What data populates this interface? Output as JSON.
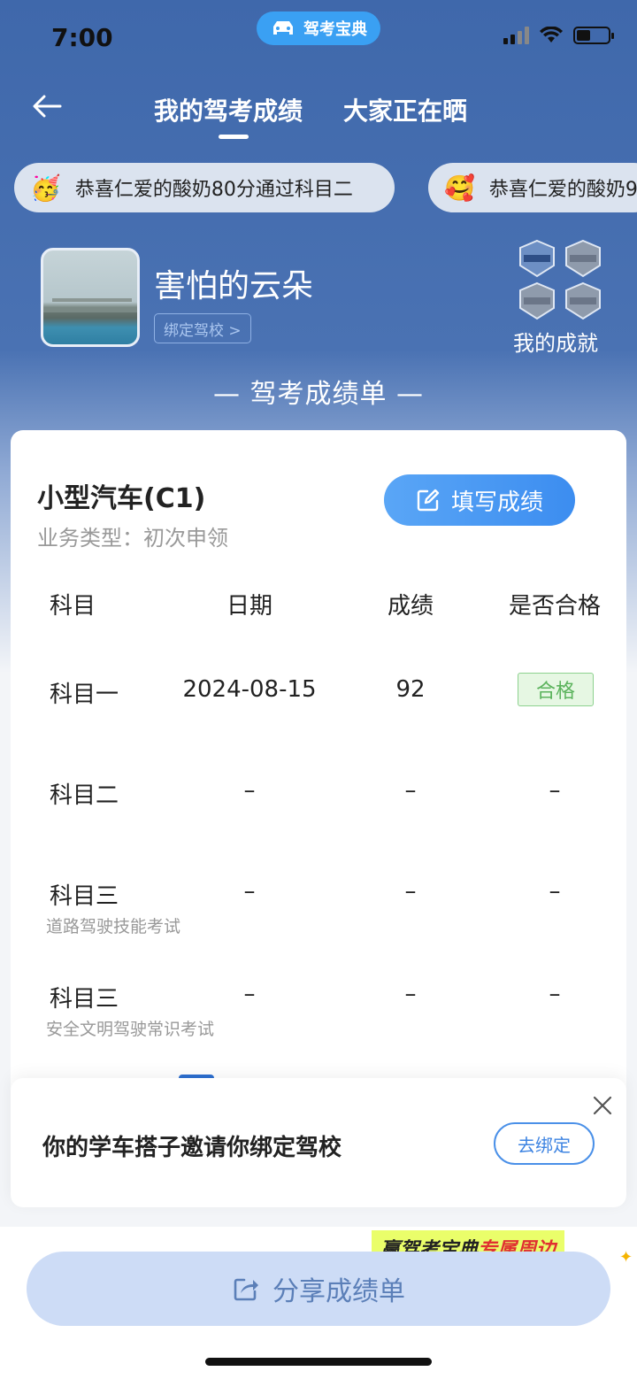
{
  "status_bar": {
    "time": "7:00",
    "app_name": "驾考宝典"
  },
  "nav": {
    "tab_active": "我的驾考成绩",
    "tab_other": "大家正在晒"
  },
  "ticker": [
    {
      "emoji": "🥳",
      "text": "恭喜仁爱的酸奶80分通过科目二"
    },
    {
      "emoji": "🥰",
      "text": "恭喜仁爱的酸奶9"
    }
  ],
  "profile": {
    "username": "害怕的云朵",
    "bind_school": "绑定驾校 >",
    "achievements_label": "我的成就"
  },
  "sheet_title": "— 驾考成绩单 —",
  "card": {
    "vehicle": "小型汽车(C1)",
    "business_type": "业务类型：初次申领",
    "fill_button": "填写成绩",
    "headers": [
      "科目",
      "日期",
      "成绩",
      "是否合格"
    ],
    "rows": [
      {
        "subject": "科目一",
        "sub": "",
        "date": "2024-08-15",
        "score": "92",
        "pass": "合格"
      },
      {
        "subject": "科目二",
        "sub": "",
        "date": "–",
        "score": "–",
        "pass": "–"
      },
      {
        "subject": "科目三",
        "sub": "道路驾驶技能考试",
        "date": "–",
        "score": "–",
        "pass": "–"
      },
      {
        "subject": "科目三",
        "sub": "安全文明驾驶常识考试",
        "date": "–",
        "score": "–",
        "pass": "–"
      }
    ]
  },
  "invite": {
    "text": "你的学车搭子邀请你绑定驾校",
    "button": "去绑定"
  },
  "promo": {
    "part1": "赢驾考宝典",
    "part2": "专属周边"
  },
  "share_button": "分享成绩单",
  "colors": {
    "hero_blue": "#4a72b3",
    "accent_blue": "#3c8df0",
    "pass_green": "#5bb35c"
  }
}
